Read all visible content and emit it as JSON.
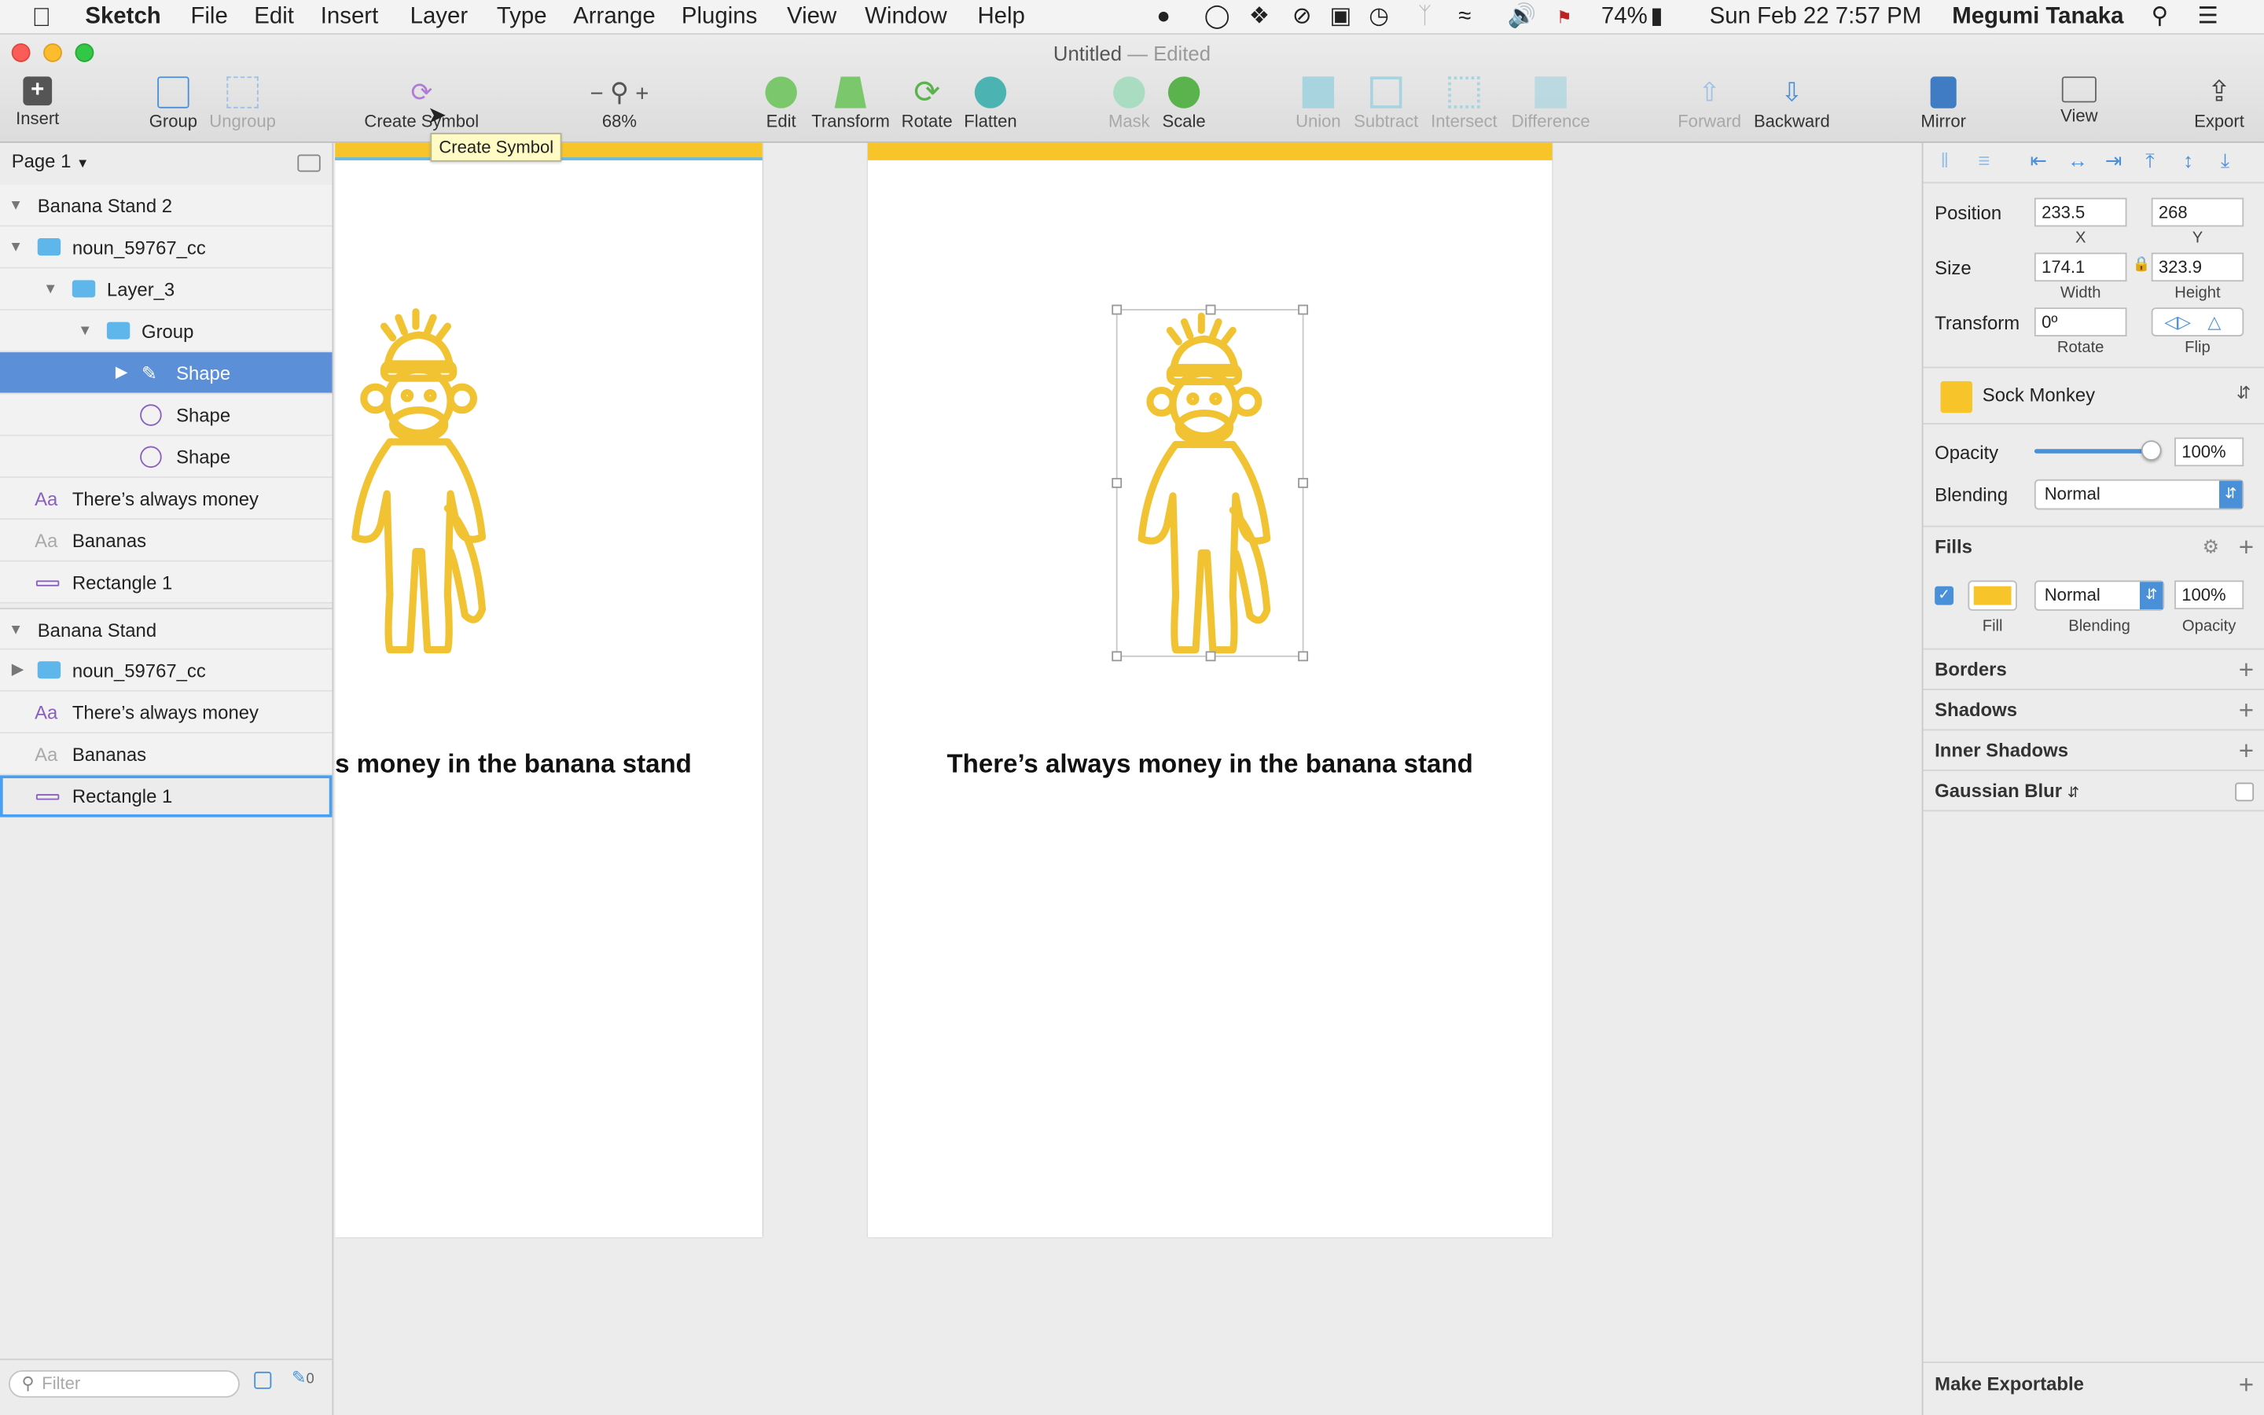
{
  "menubar": {
    "app": "Sketch",
    "menus": [
      "File",
      "Edit",
      "Insert",
      "Layer",
      "Type",
      "Arrange",
      "Plugins",
      "View",
      "Window",
      "Help"
    ],
    "battery": "74%",
    "clock": "Sun Feb 22  7:57 PM",
    "user": "Megumi Tanaka"
  },
  "window": {
    "title": "Untitled",
    "status": "— Edited"
  },
  "toolbar": {
    "insert": "Insert",
    "group": "Group",
    "ungroup": "Ungroup",
    "create_symbol": "Create Symbol",
    "zoom_level": "68%",
    "zoom_minus": "−",
    "zoom_plus": "+",
    "edit": "Edit",
    "transform": "Transform",
    "rotate": "Rotate",
    "flatten": "Flatten",
    "mask": "Mask",
    "scale": "Scale",
    "union": "Union",
    "subtract": "Subtract",
    "intersect": "Intersect",
    "difference": "Difference",
    "forward": "Forward",
    "backward": "Backward",
    "mirror": "Mirror",
    "view": "View",
    "export": "Export",
    "tooltip": "Create Symbol"
  },
  "layers": {
    "page": "Page 1",
    "rows": [
      {
        "label": "Banana Stand 2"
      },
      {
        "label": "noun_59767_cc"
      },
      {
        "label": "Layer_3"
      },
      {
        "label": "Group"
      },
      {
        "label": "Shape"
      },
      {
        "label": "Shape"
      },
      {
        "label": "Shape"
      },
      {
        "label": "There’s always money"
      },
      {
        "label": "Bananas"
      },
      {
        "label": "Rectangle 1"
      },
      {
        "label": "Banana Stand"
      },
      {
        "label": "noun_59767_cc"
      },
      {
        "label": "There’s always money"
      },
      {
        "label": "Bananas"
      },
      {
        "label": "Rectangle 1"
      }
    ],
    "filter_placeholder": "Filter",
    "filter_count": "0"
  },
  "canvas": {
    "headline_left": "s money in the banana stand",
    "headline_right": "There’s always money in the banana stand"
  },
  "inspector": {
    "position_label": "Position",
    "x": "233.5",
    "x_label": "X",
    "y": "268",
    "y_label": "Y",
    "size_label": "Size",
    "width": "174.1",
    "width_label": "Width",
    "height": "323.9",
    "height_label": "Height",
    "transform_label": "Transform",
    "rotate": "0º",
    "rotate_label": "Rotate",
    "flip_label": "Flip",
    "shared_style": "Sock Monkey",
    "opacity_label": "Opacity",
    "opacity": "100%",
    "opacity_level": 1.0,
    "blending_label": "Blending",
    "blending": "Normal",
    "fills_label": "Fills",
    "fill_label": "Fill",
    "fill_blending": "Normal",
    "fill_blending_label": "Blending",
    "fill_opacity": "100%",
    "fill_opacity_label": "Opacity",
    "borders": "Borders",
    "shadows": "Shadows",
    "inner_shadows": "Inner Shadows",
    "gaussian_blur": "Gaussian Blur",
    "make_exportable": "Make Exportable"
  },
  "colors": {
    "accent": "#f7c52a",
    "selection": "#5b8fd8"
  }
}
